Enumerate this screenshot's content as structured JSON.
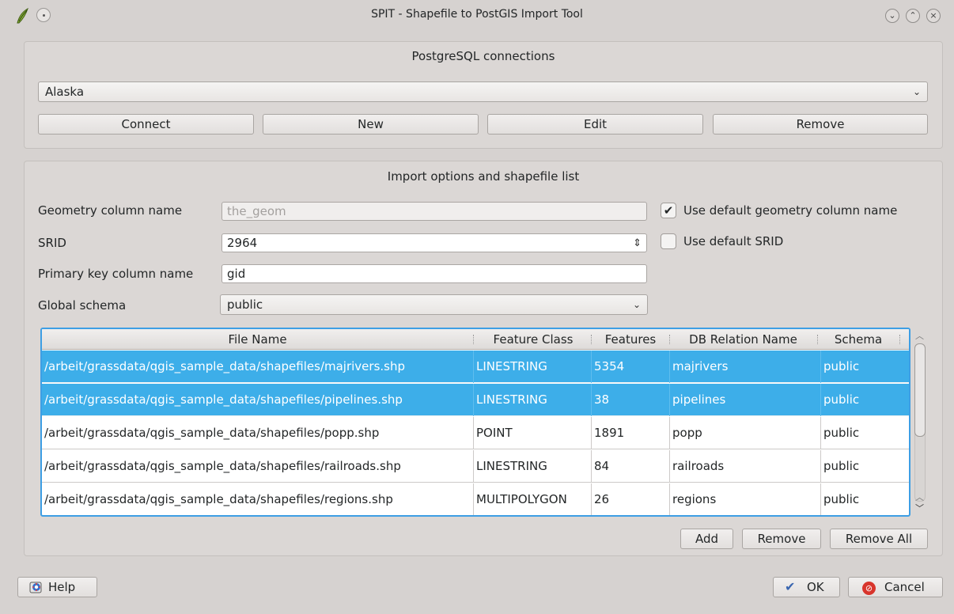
{
  "window": {
    "title": "SPIT - Shapefile to PostGIS Import Tool",
    "controls": [
      "minimize-icon",
      "maximize-icon",
      "close-icon"
    ]
  },
  "connections": {
    "group_title": "PostgreSQL connections",
    "selected": "Alaska",
    "buttons": {
      "connect": "Connect",
      "new": "New",
      "edit": "Edit",
      "remove": "Remove"
    }
  },
  "import_options": {
    "group_title": "Import options and shapefile list",
    "geometry_label": "Geometry column name",
    "geometry_value": "the_geom",
    "use_default_geometry_label": "Use default geometry column name",
    "use_default_geometry_checked": true,
    "srid_label": "SRID",
    "srid_value": "2964",
    "use_default_srid_label": "Use default SRID",
    "use_default_srid_checked": false,
    "pk_label": "Primary key column name",
    "pk_value": "gid",
    "schema_label": "Global schema",
    "schema_value": "public"
  },
  "table": {
    "headers": [
      "File Name",
      "Feature Class",
      "Features",
      "DB Relation Name",
      "Schema"
    ],
    "rows": [
      {
        "file": "/arbeit/grassdata/qgis_sample_data/shapefiles/majrivers.shp",
        "class": "LINESTRING",
        "features": "5354",
        "relation": "majrivers",
        "schema": "public",
        "selected": true
      },
      {
        "file": "/arbeit/grassdata/qgis_sample_data/shapefiles/pipelines.shp",
        "class": "LINESTRING",
        "features": "38",
        "relation": "pipelines",
        "schema": "public",
        "selected": true
      },
      {
        "file": "/arbeit/grassdata/qgis_sample_data/shapefiles/popp.shp",
        "class": "POINT",
        "features": "1891",
        "relation": "popp",
        "schema": "public",
        "selected": false
      },
      {
        "file": "/arbeit/grassdata/qgis_sample_data/shapefiles/railroads.shp",
        "class": "LINESTRING",
        "features": "84",
        "relation": "railroads",
        "schema": "public",
        "selected": false
      },
      {
        "file": "/arbeit/grassdata/qgis_sample_data/shapefiles/regions.shp",
        "class": "MULTIPOLYGON",
        "features": "26",
        "relation": "regions",
        "schema": "public",
        "selected": false
      }
    ]
  },
  "list_buttons": {
    "add": "Add",
    "remove": "Remove",
    "remove_all": "Remove All"
  },
  "footer": {
    "help": "Help",
    "ok": "OK",
    "cancel": "Cancel"
  },
  "colors": {
    "selection": "#3daee9",
    "window_bg": "#d6d2d0"
  }
}
